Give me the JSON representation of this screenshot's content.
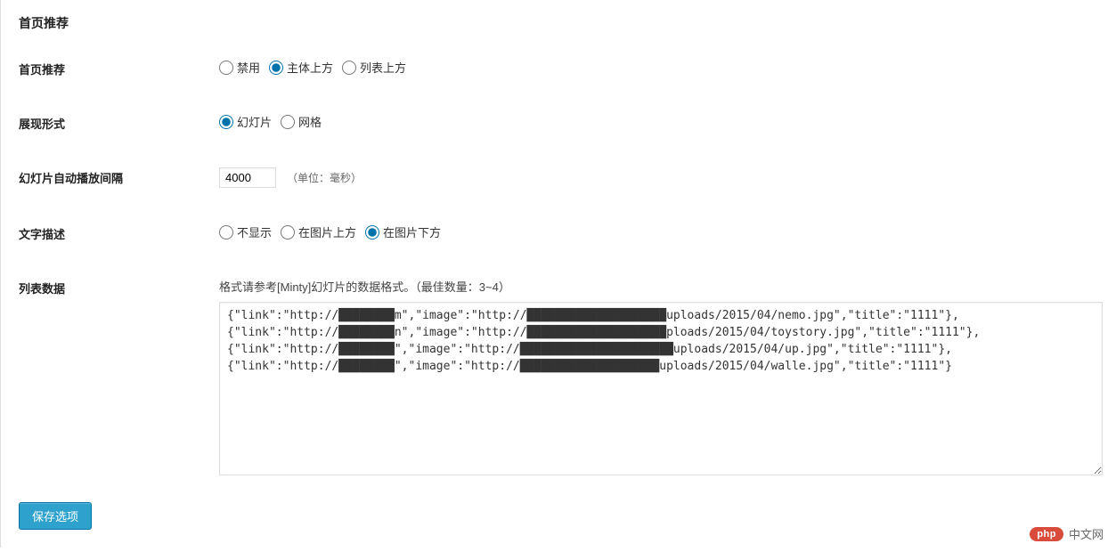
{
  "section_title": "首页推荐",
  "rows": {
    "recommend": {
      "label": "首页推荐",
      "options": {
        "disable": "禁用",
        "above_body": "主体上方",
        "above_list": "列表上方"
      },
      "selected": "above_body"
    },
    "display_mode": {
      "label": "展现形式",
      "options": {
        "slide": "幻灯片",
        "grid": "网格"
      },
      "selected": "slide"
    },
    "interval": {
      "label": "幻灯片自动播放间隔",
      "value": "4000",
      "hint": "（单位：毫秒）"
    },
    "text_desc": {
      "label": "文字描述",
      "options": {
        "none": "不显示",
        "above_img": "在图片上方",
        "below_img": "在图片下方"
      },
      "selected": "below_img"
    },
    "list_data": {
      "label": "列表数据",
      "desc": "格式请参考[Minty]幻灯片的数据格式。（最佳数量：3~4）",
      "value": "{\"link\":\"http://████████m\",\"image\":\"http://████████████████████uploads/2015/04/nemo.jpg\",\"title\":\"1111\"},\n{\"link\":\"http://████████n\",\"image\":\"http://████████████████████ploads/2015/04/toystory.jpg\",\"title\":\"1111\"},\n{\"link\":\"http://████████\",\"image\":\"http://██████████████████████uploads/2015/04/up.jpg\",\"title\":\"1111\"},\n{\"link\":\"http://████████\",\"image\":\"http://████████████████████uploads/2015/04/walle.jpg\",\"title\":\"1111\"}"
    }
  },
  "buttons": {
    "save": "保存选项"
  },
  "watermark": {
    "badge": "php",
    "text": "中文网"
  }
}
